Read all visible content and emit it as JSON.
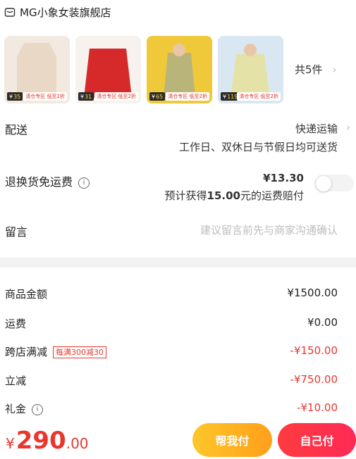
{
  "shop": {
    "name": "MG小象女装旗舰店",
    "icon": "store-icon"
  },
  "items": [
    {
      "price": "35",
      "promo": "清仓专区 低至2折",
      "color": "#efe2d6"
    },
    {
      "price": "31",
      "promo": "清仓专区 低至2折",
      "color": "#d62a2a"
    },
    {
      "price": "65",
      "promo": "清仓专区 低至2折",
      "color": "#d8c07a"
    },
    {
      "price": "119",
      "promo": "清仓专区 低至2折",
      "color": "#d7d29a"
    }
  ],
  "count": {
    "text": "共5件",
    "arrow": "›"
  },
  "delivery": {
    "label": "配送",
    "method": "快递运输",
    "note": "工作日、双休日与节假日均可送货"
  },
  "return_insurance": {
    "label": "退换货免运费",
    "price": "¥13.30",
    "note_prefix": "预计获得",
    "note_amount": "15.00",
    "note_suffix": "元的运费赔付",
    "enabled": false
  },
  "message": {
    "label": "留言",
    "placeholder": "建议留言前先与商家沟通确认"
  },
  "summary": {
    "goods": {
      "label": "商品金额",
      "value": "¥1500.00"
    },
    "shipping": {
      "label": "运费",
      "value": "¥0.00"
    },
    "cross_store": {
      "label": "跨店满减",
      "badge": "每满300减30",
      "value": "-¥150.00"
    },
    "instant": {
      "label": "立减",
      "value": "-¥750.00"
    },
    "gift": {
      "label": "礼金",
      "value": "-¥10.00"
    }
  },
  "total": {
    "currency": "¥",
    "integer": "290",
    "decimal": ".00"
  },
  "buttons": {
    "help": "帮我付",
    "self": "自己付"
  }
}
